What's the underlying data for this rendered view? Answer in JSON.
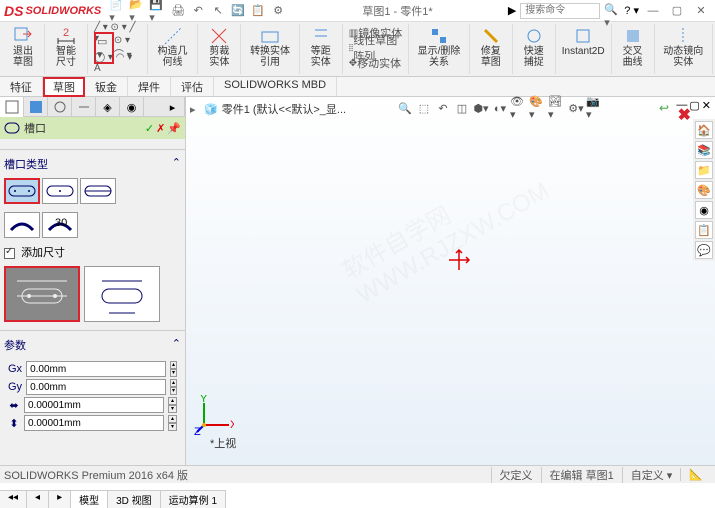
{
  "app": {
    "name": "SOLIDWORKS",
    "title": "草图1 - 零件1*"
  },
  "search": {
    "placeholder": "搜索命令"
  },
  "ribbon": {
    "exit_sketch": "退出草图",
    "smart_dim": "智能尺寸",
    "construction": "构造几何线",
    "trim": "剪裁实体",
    "convert": "转换实体引用",
    "offset": "等距实体",
    "mirror": "镜像实体",
    "linear_pattern": "线性草图阵列",
    "move": "移动实体",
    "display_delete": "显示/删除关系",
    "repair": "修复草图",
    "quick_snap": "快速捕捉",
    "instant2d": "Instant2D",
    "shaded": "交叉曲线",
    "dynamic_mirror": "动态镜向实体"
  },
  "tabs": {
    "features": "特征",
    "sketch": "草图",
    "sheetmetal": "钣金",
    "weldments": "焊件",
    "evaluate": "评估",
    "mbd": "SOLIDWORKS MBD"
  },
  "feature_tree": {
    "title": "槽口"
  },
  "slot": {
    "section_title": "槽口类型",
    "add_dim": "添加尺寸"
  },
  "params": {
    "title": "参数",
    "p1": "0.00mm",
    "p2": "0.00mm",
    "p3": "0.00001mm",
    "p4": "0.00001mm"
  },
  "breadcrumb": {
    "part": "零件1 (默认<<默认>_显..."
  },
  "view_label": "*上视",
  "bottom_tabs": {
    "model": "模型",
    "view3d": "3D 视图",
    "motion": "运动算例 1"
  },
  "status": {
    "version": "SOLIDWORKS Premium 2016 x64 版",
    "underdefined": "欠定义",
    "editing": "在编辑 草图1",
    "custom": "自定义"
  }
}
